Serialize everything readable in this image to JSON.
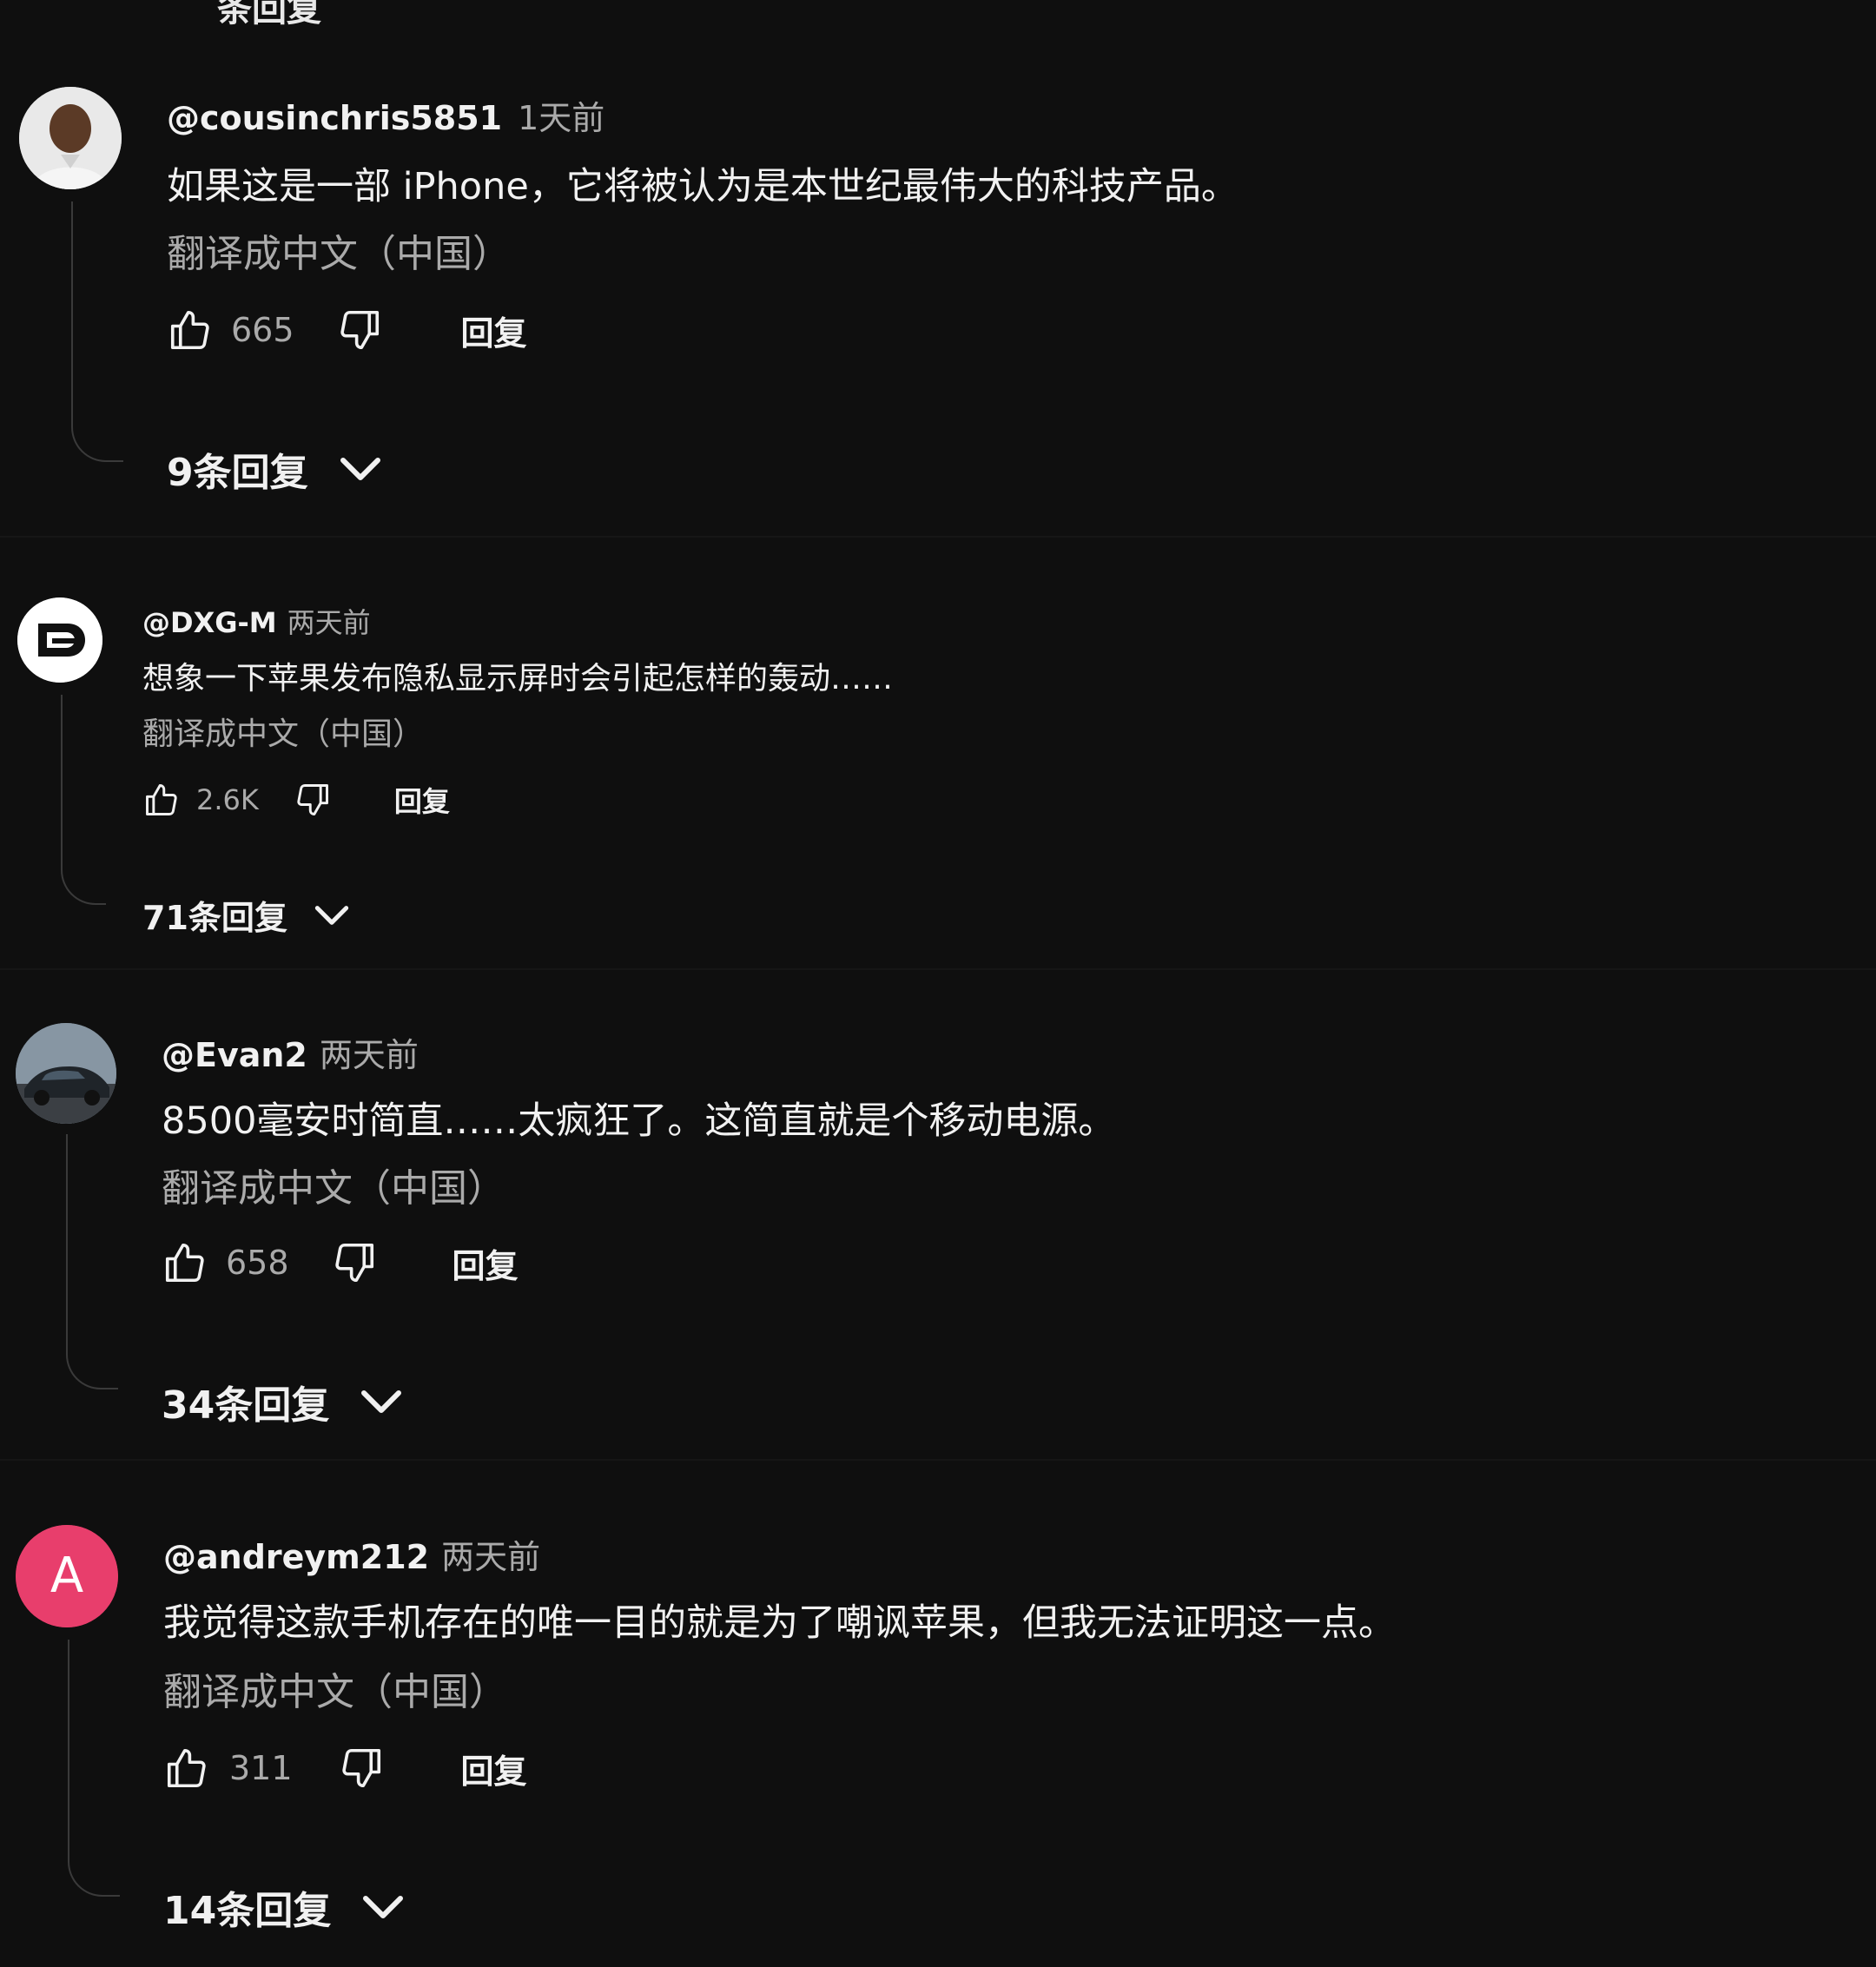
{
  "top_fragment": "条回复",
  "comments": [
    {
      "author": "@cousinchris5851",
      "time": "1天前",
      "text": "如果这是一部 iPhone，它将被认为是本世纪最伟大的科技产品。",
      "translate": "翻译成中文（中国）",
      "likes": "665",
      "reply": "回复",
      "replies": "9条回复",
      "avatar_icon": "person-photo-icon"
    },
    {
      "author": "@DXG-M",
      "time": "两天前",
      "text": "想象一下苹果发布隐私显示屏时会引起怎样的轰动……",
      "translate": "翻译成中文（中国）",
      "likes": "2.6K",
      "reply": "回复",
      "replies": "71条回复",
      "avatar_icon": "dxg-logo-icon"
    },
    {
      "author": "@Evan2",
      "time": "两天前",
      "text": "8500毫安时简直……太疯狂了。这简直就是个移动电源。",
      "translate": "翻译成中文（中国）",
      "likes": "658",
      "reply": "回复",
      "replies": "34条回复",
      "avatar_icon": "car-photo-icon"
    },
    {
      "author": "@andreym212",
      "time": "两天前",
      "text": "我觉得这款手机存在的唯一目的就是为了嘲讽苹果，但我无法证明这一点。",
      "translate": "翻译成中文（中国）",
      "likes": "311",
      "reply": "回复",
      "replies": "14条回复",
      "avatar_icon": "letter-avatar-icon",
      "avatar_letter": "A",
      "avatar_color": "#e83e6c"
    }
  ]
}
